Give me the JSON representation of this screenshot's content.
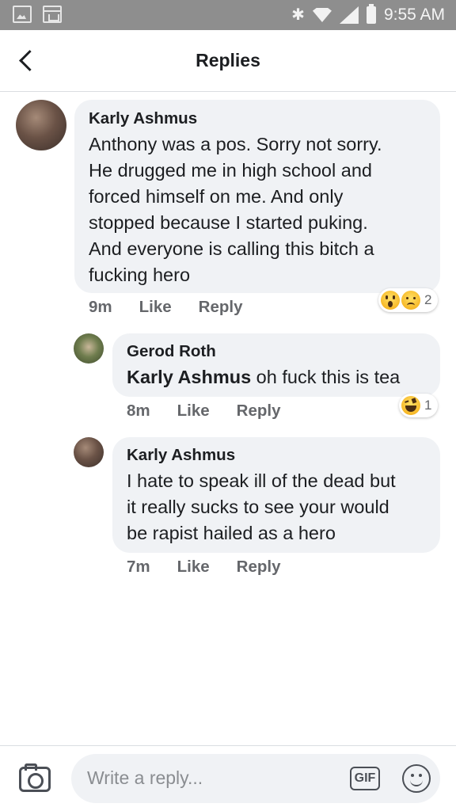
{
  "status_bar": {
    "time": "9:55 AM",
    "icons": [
      "gallery-icon",
      "calendar-icon",
      "bluetooth-icon",
      "wifi-icon",
      "signal-icon",
      "battery-icon"
    ]
  },
  "header": {
    "title": "Replies",
    "back_icon": "back-arrow-icon"
  },
  "comments": [
    {
      "author": "Karly Ashmus",
      "text": "Anthony was a pos. Sorry not sorry.\nHe drugged me in high school and\nforced himself on me. And only\nstopped because I started puking.\nAnd everyone is calling this bitch a\nfucking hero",
      "time": "9m",
      "like_label": "Like",
      "reply_label": "Reply",
      "reactions": [
        "wow",
        "sad"
      ],
      "reaction_count": "2"
    },
    {
      "author": "Gerod Roth",
      "mention": "Karly Ashmus",
      "text": " oh fuck this is tea",
      "time": "8m",
      "like_label": "Like",
      "reply_label": "Reply",
      "reactions": [
        "haha"
      ],
      "reaction_count": "1"
    },
    {
      "author": "Karly Ashmus",
      "text": "I hate to speak ill of the dead but\nit really sucks to see your would\nbe rapist hailed as a hero",
      "time": "7m",
      "like_label": "Like",
      "reply_label": "Reply"
    }
  ],
  "composer": {
    "placeholder": "Write a reply...",
    "gif_label": "GIF",
    "camera_icon": "camera-icon",
    "emoji_icon": "smiley-icon"
  },
  "colors": {
    "bubble": "#f0f2f5",
    "status_bar": "#8e8e8e",
    "meta_text": "#65676b"
  }
}
